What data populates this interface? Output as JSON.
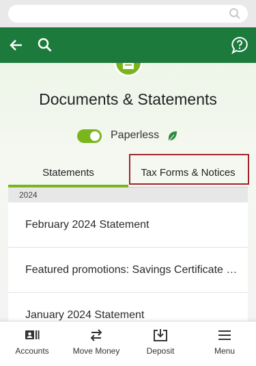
{
  "browser": {
    "search_icon": "search-icon"
  },
  "header": {
    "back_icon": "arrow-left-icon",
    "search_icon": "search-icon",
    "help_icon": "help-chat-icon",
    "bg_color": "#1b7a3c"
  },
  "page": {
    "badge_icon": "document-icon",
    "title": "Documents & Statements",
    "paperless": {
      "label": "Paperless",
      "enabled": true,
      "icon": "leaf-icon"
    },
    "accent_color": "#7ab51d"
  },
  "tabs": [
    {
      "label": "Statements",
      "active": true
    },
    {
      "label": "Tax Forms & Notices",
      "active": false,
      "highlighted": true
    }
  ],
  "year_group": "2024",
  "statements": [
    "February 2024 Statement",
    "Featured promotions: Savings Certificate Specials",
    "January 2024 Statement"
  ],
  "bottom_nav": [
    {
      "label": "Accounts",
      "icon": "accounts-icon"
    },
    {
      "label": "Move Money",
      "icon": "transfer-arrows-icon"
    },
    {
      "label": "Deposit",
      "icon": "deposit-icon"
    },
    {
      "label": "Menu",
      "icon": "hamburger-menu-icon"
    }
  ]
}
